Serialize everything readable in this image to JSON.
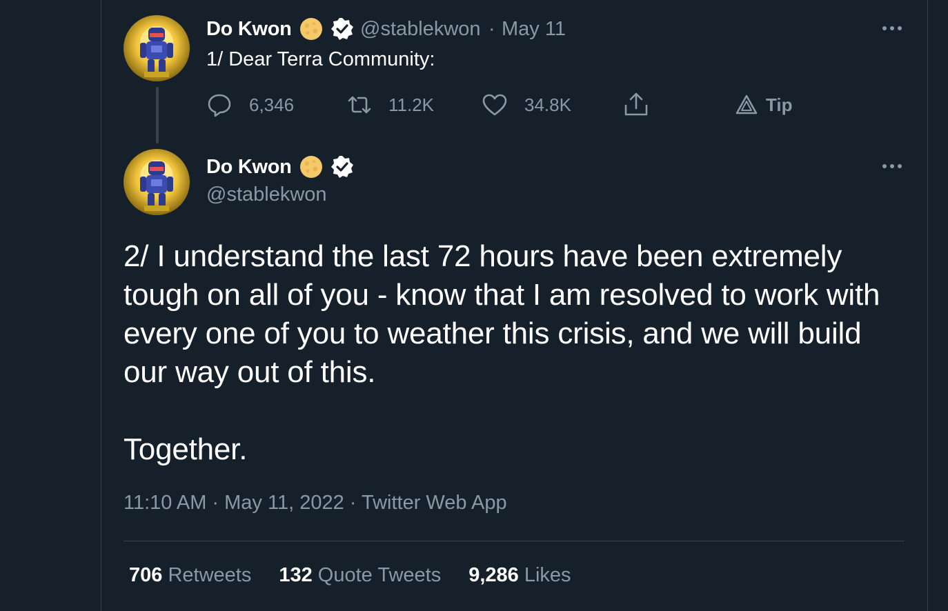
{
  "tweet1": {
    "author_name": "Do Kwon",
    "handle": "@stablekwon",
    "separator": "·",
    "date": "May 11",
    "text": "1/ Dear Terra Community:",
    "replies": "6,346",
    "retweets": "11.2K",
    "likes": "34.8K",
    "tip_label": "Tip"
  },
  "tweet2": {
    "author_name": "Do Kwon",
    "handle": "@stablekwon",
    "text_para1": "2/ I understand the last 72 hours have been extremely tough on all of you - know that I am resolved to work with every one of you to weather this crisis, and we will build our way out of this.",
    "text_para2": "Together.",
    "timestamp": "11:10 AM · May 11, 2022 · Twitter Web App",
    "stats": {
      "retweets_count": "706",
      "retweets_label": "Retweets",
      "quote_count": "132",
      "quote_label": "Quote Tweets",
      "likes_count": "9,286",
      "likes_label": "Likes"
    }
  },
  "icons": {
    "reply": "reply-icon",
    "retweet": "retweet-icon",
    "like": "heart-icon",
    "share": "share-icon",
    "tip": "tip-icon",
    "more": "more-icon",
    "verified": "verified-badge-icon",
    "moon": "moon-emoji-icon"
  },
  "colors": {
    "background": "#15202b",
    "text_primary": "#ffffff",
    "text_secondary": "#8b98a5",
    "border": "#38444d",
    "moon": "#f5c96a"
  }
}
